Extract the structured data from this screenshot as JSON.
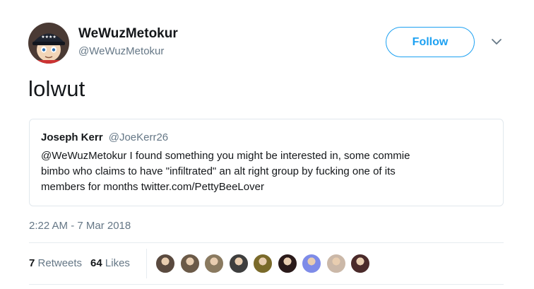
{
  "author": {
    "name": "WeWuzMetokur",
    "handle": "@WeWuzMetokur",
    "avatar_icon": "cartoon-character-avatar"
  },
  "follow_label": "Follow",
  "caret_icon": "chevron-down-icon",
  "text": "lolwut",
  "quoted": {
    "name": "Joseph Kerr",
    "handle": "@JoeKerr26",
    "lines": [
      "@WeWuzMetokur I found something you might be interested in, some commie",
      "bimbo who claims to have \"infiltrated\" an alt right group by fucking one of its",
      "members for months twitter.com/PettyBeeLover"
    ]
  },
  "timestamp": "2:22 AM - 7 Mar 2018",
  "stats": {
    "retweets_count": "7",
    "retweets_label": "Retweets",
    "likes_count": "64",
    "likes_label": "Likes"
  },
  "colors": {
    "accent": "#1da1f2",
    "secondary_text": "#657786",
    "primary_text": "#14171a",
    "border": "#e1e8ed"
  },
  "liker_colors": [
    "#5a4a3f",
    "#6b5a48",
    "#8a7a60",
    "#3e3e3e",
    "#7a6a2a",
    "#2a1a1a",
    "#7e8be8",
    "#cbb8a8",
    "#4a2a2a"
  ]
}
